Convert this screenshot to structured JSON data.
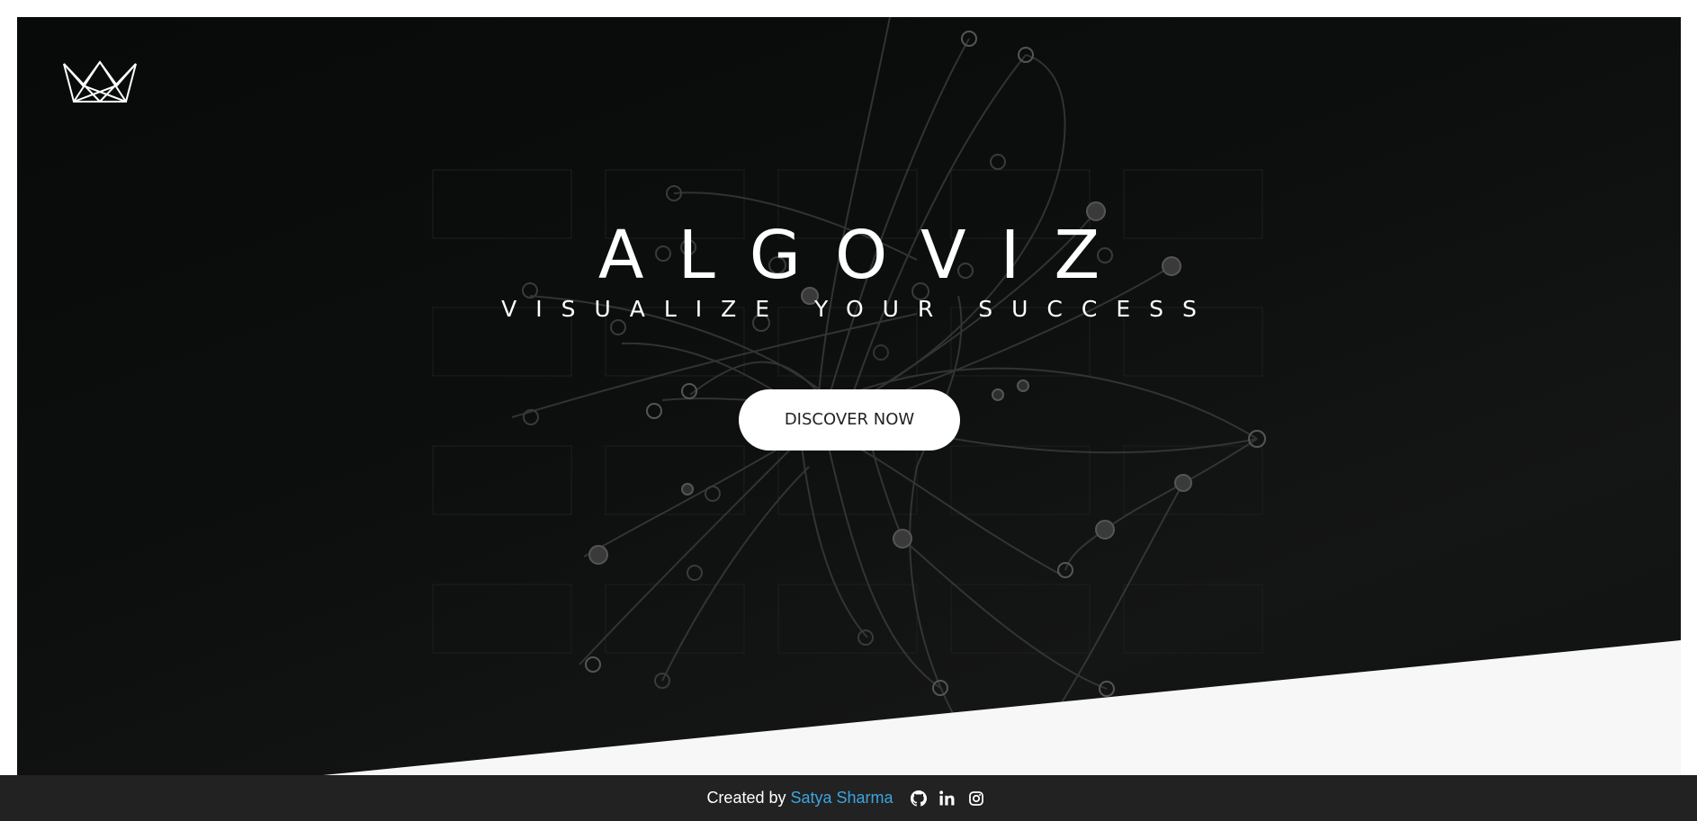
{
  "hero": {
    "logo_icon": "crown-logo-icon",
    "title": "ALGOVIZ",
    "subtitle": "VISUALIZE YOUR SUCCESS",
    "cta_label": "DISCOVER NOW"
  },
  "footer": {
    "credit_prefix": "Created by",
    "author_name": "Satya Sharma",
    "author_color": "#3aa6e0",
    "social_icons": [
      "github-icon",
      "linkedin-icon",
      "instagram-icon"
    ]
  },
  "colors": {
    "hero_background": "#0b0d0d",
    "footer_background": "#222222",
    "page_background": "#ffffff",
    "diagonal_band": "#f7f7f7",
    "network_lines": "#4a4a4a"
  }
}
